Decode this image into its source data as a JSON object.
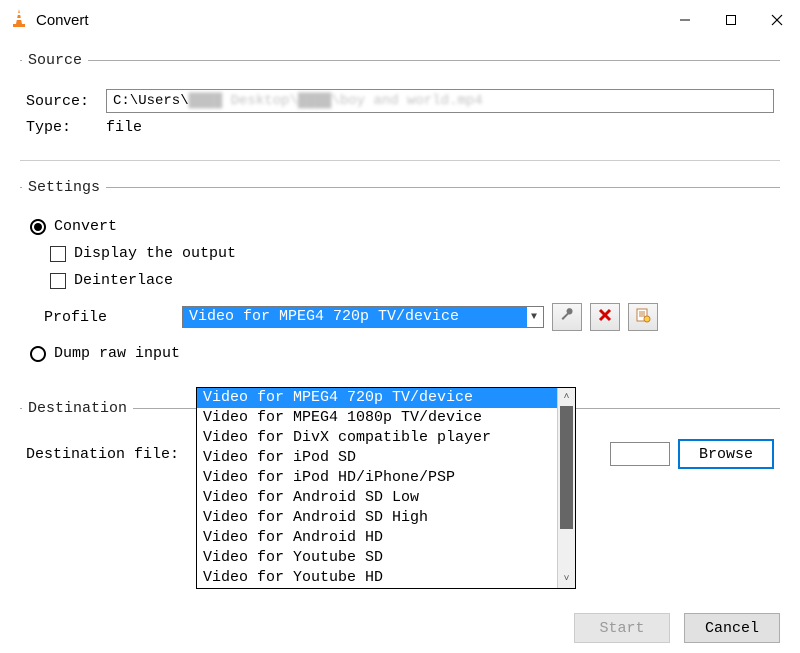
{
  "window": {
    "title": "Convert"
  },
  "source": {
    "legend": "Source",
    "source_label": "Source:",
    "source_value_prefix": "C:\\Users\\",
    "source_value_blurred": "████ Desktop\\████\\boy and world.mp4",
    "type_label": "Type:",
    "type_value": "file"
  },
  "settings": {
    "legend": "Settings",
    "convert_label": "Convert",
    "display_output_label": "Display the output",
    "deinterlace_label": "Deinterlace",
    "profile_label": "Profile",
    "profile_selected": "Video for MPEG4 720p TV/device",
    "profile_options": [
      "Video for MPEG4 720p TV/device",
      "Video for MPEG4 1080p TV/device",
      "Video for DivX compatible player",
      "Video for iPod SD",
      "Video for iPod HD/iPhone/PSP",
      "Video for Android SD Low",
      "Video for Android SD High",
      "Video for Android HD",
      "Video for Youtube SD",
      "Video for Youtube HD"
    ],
    "dump_raw_label": "Dump raw input"
  },
  "destination": {
    "legend": "Destination",
    "file_label": "Destination file:",
    "browse_label": "Browse"
  },
  "buttons": {
    "start": "Start",
    "cancel": "Cancel"
  }
}
